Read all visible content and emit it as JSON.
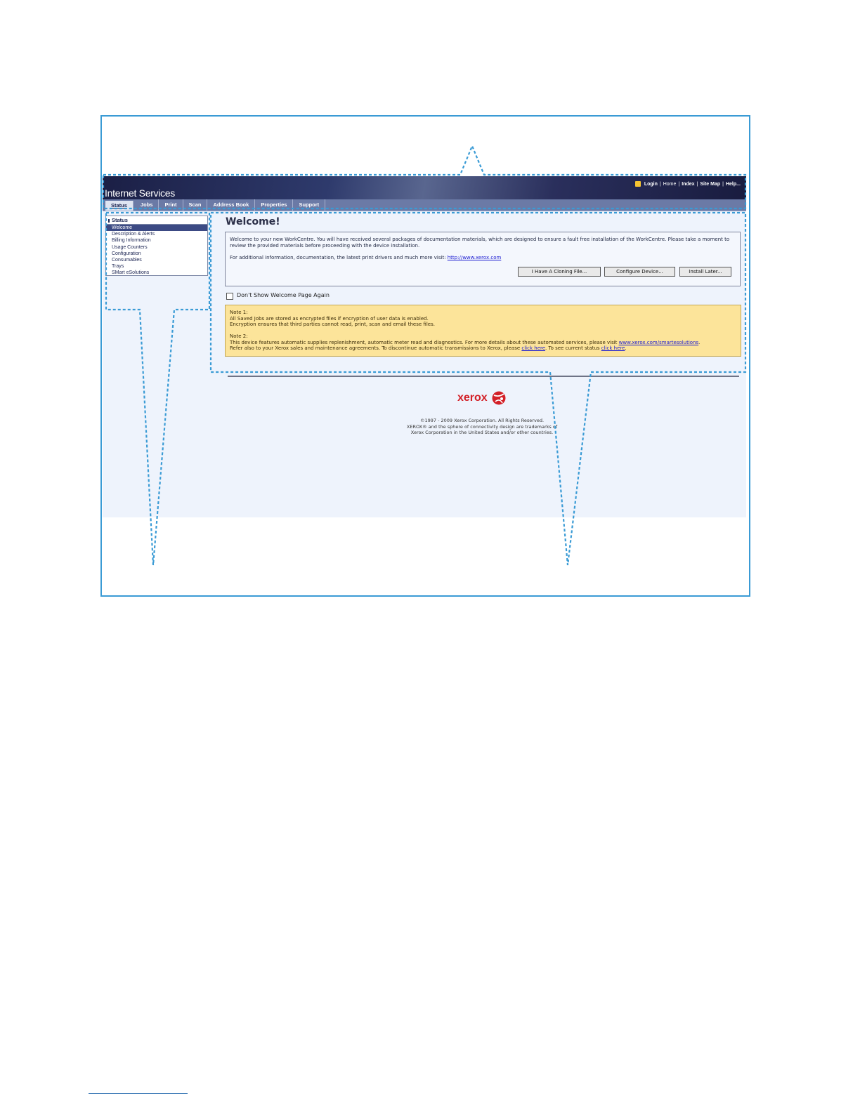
{
  "header": {
    "app_title": "Internet Services",
    "links": [
      "Login",
      "Home",
      "Index",
      "Site Map",
      "Help..."
    ],
    "separator": "|"
  },
  "tabs": [
    "Status",
    "Jobs",
    "Print",
    "Scan",
    "Address Book",
    "Properties",
    "Support"
  ],
  "sidebar": {
    "heading": "Status",
    "items": [
      "Welcome",
      "Description & Alerts",
      "Billing Information",
      "Usage Counters",
      "Configuration",
      "Consumables",
      "Trays",
      "SMart eSolutions"
    ]
  },
  "main": {
    "title": "Welcome!",
    "intro_1": "Welcome to your new WorkCentre. You will have received several packages of documentation materials, which are designed to ensure a fault free installation of the WorkCentre. Please take a moment to review the provided materials before proceeding with the device installation.",
    "intro_2_prefix": "For additional information, documentation, the latest print drivers and much more visit: ",
    "intro_2_link": "http://www.xerox.com",
    "buttons": {
      "cloning": "I Have A Cloning File...",
      "configure": "Configure Device...",
      "later": "Install Later..."
    },
    "checkbox_label": "Don't Show Welcome Page Again",
    "note1_title": "Note 1:",
    "note1_line1": "All Saved Jobs are stored as encrypted files if encryption of user data is enabled.",
    "note1_line2": "Encryption ensures that third parties cannot read, print, scan and email these files.",
    "note2_title": "Note 2:",
    "note2_line1_prefix": "This device features automatic supplies replenishment, automatic meter read and diagnostics. For more details about these automated services, please visit ",
    "note2_line1_link": "www.xerox.com/smartesolutions",
    "note2_line1_suffix": ".",
    "note2_line2_prefix": "Refer also to your Xerox sales and maintenance agreements. To discontinue automatic transmissions to Xerox, please ",
    "note2_link_a": "click here",
    "note2_line2_mid": ". To see current status ",
    "note2_link_b": "click here",
    "note2_line2_suffix": "."
  },
  "footer": {
    "logo_text": "xerox",
    "copyright_1": "©1997 - 2009 Xerox Corporation. All Rights Reserved.",
    "copyright_2": "XEROX® and the sphere of connectivity design are trademarks of",
    "copyright_3": "Xerox Corporation in the United States and/or other countries."
  },
  "colors": {
    "annotation": "#3a9bd5",
    "header": "#1b1f45",
    "note_background": "#fce49a",
    "brand_red": "#d32027"
  }
}
